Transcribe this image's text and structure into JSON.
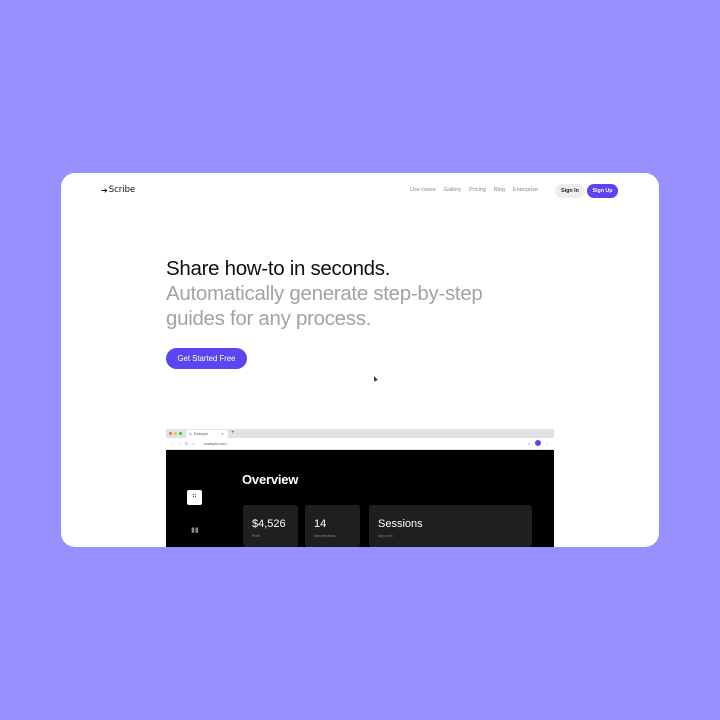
{
  "nav": {
    "logo": "Scribe",
    "links": [
      "Use cases",
      "Gallery",
      "Pricing",
      "Blog",
      "Enterprise"
    ],
    "sign_in": "Sign In",
    "sign_up": "Sign Up"
  },
  "hero": {
    "title": "Share how-to in seconds.",
    "subtitle": "Automatically generate step-by-step guides for any process.",
    "cta": "Get Started Free"
  },
  "browser": {
    "tab_title": "Example",
    "url": "example.com",
    "app": {
      "heading": "Overview",
      "stats": [
        {
          "value": "$4,526",
          "label": "Profit"
        },
        {
          "value": "14",
          "label": "New feedback"
        },
        {
          "value": "Sessions",
          "label": "avg a min"
        }
      ]
    }
  },
  "colors": {
    "background": "#9890ff",
    "accent": "#5b45f0",
    "card": "#ffffff"
  },
  "icons": [
    "scribe-logo-icon",
    "grid-icon",
    "bar-chart-icon",
    "cursor-icon"
  ]
}
